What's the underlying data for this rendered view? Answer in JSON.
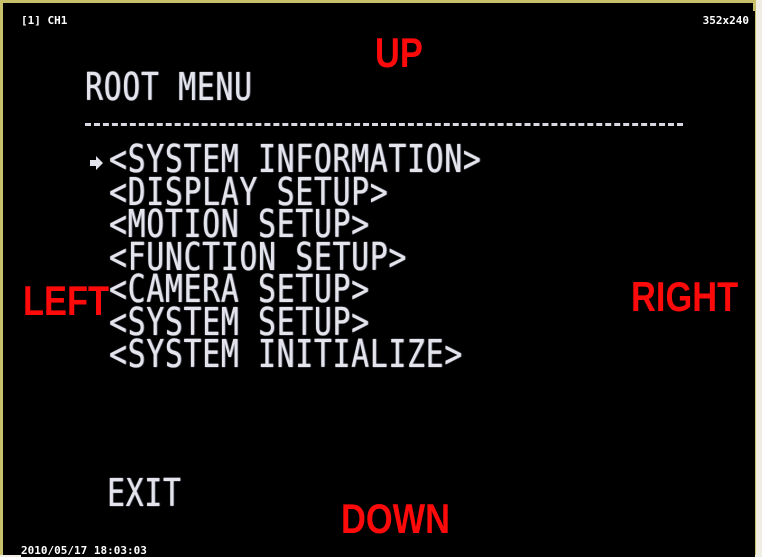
{
  "overlay": {
    "channel": "[1] CH1",
    "resolution": "352x240",
    "timestamp": "2010/05/17 18:03:03"
  },
  "menu": {
    "title": "ROOT MENU",
    "divider": "------------------------",
    "cursor_icon": "right-arrow-cursor-icon",
    "items": [
      {
        "label": "<SYSTEM INFORMATION>"
      },
      {
        "label": "<DISPLAY SETUP>"
      },
      {
        "label": "<MOTION SETUP>"
      },
      {
        "label": "<FUNCTION SETUP>"
      },
      {
        "label": "<CAMERA SETUP>"
      },
      {
        "label": "<SYSTEM SETUP>"
      },
      {
        "label": "<SYSTEM INITIALIZE>"
      }
    ],
    "selected_index": 0,
    "exit_label": "EXIT"
  },
  "directions": {
    "up": "UP",
    "down": "DOWN",
    "left": "LEFT",
    "right": "RIGHT",
    "color": "#ff0a0a"
  },
  "colors": {
    "background": "#000000",
    "osd_text": "#e4e4ec",
    "frame_border": "#c8c06a"
  }
}
